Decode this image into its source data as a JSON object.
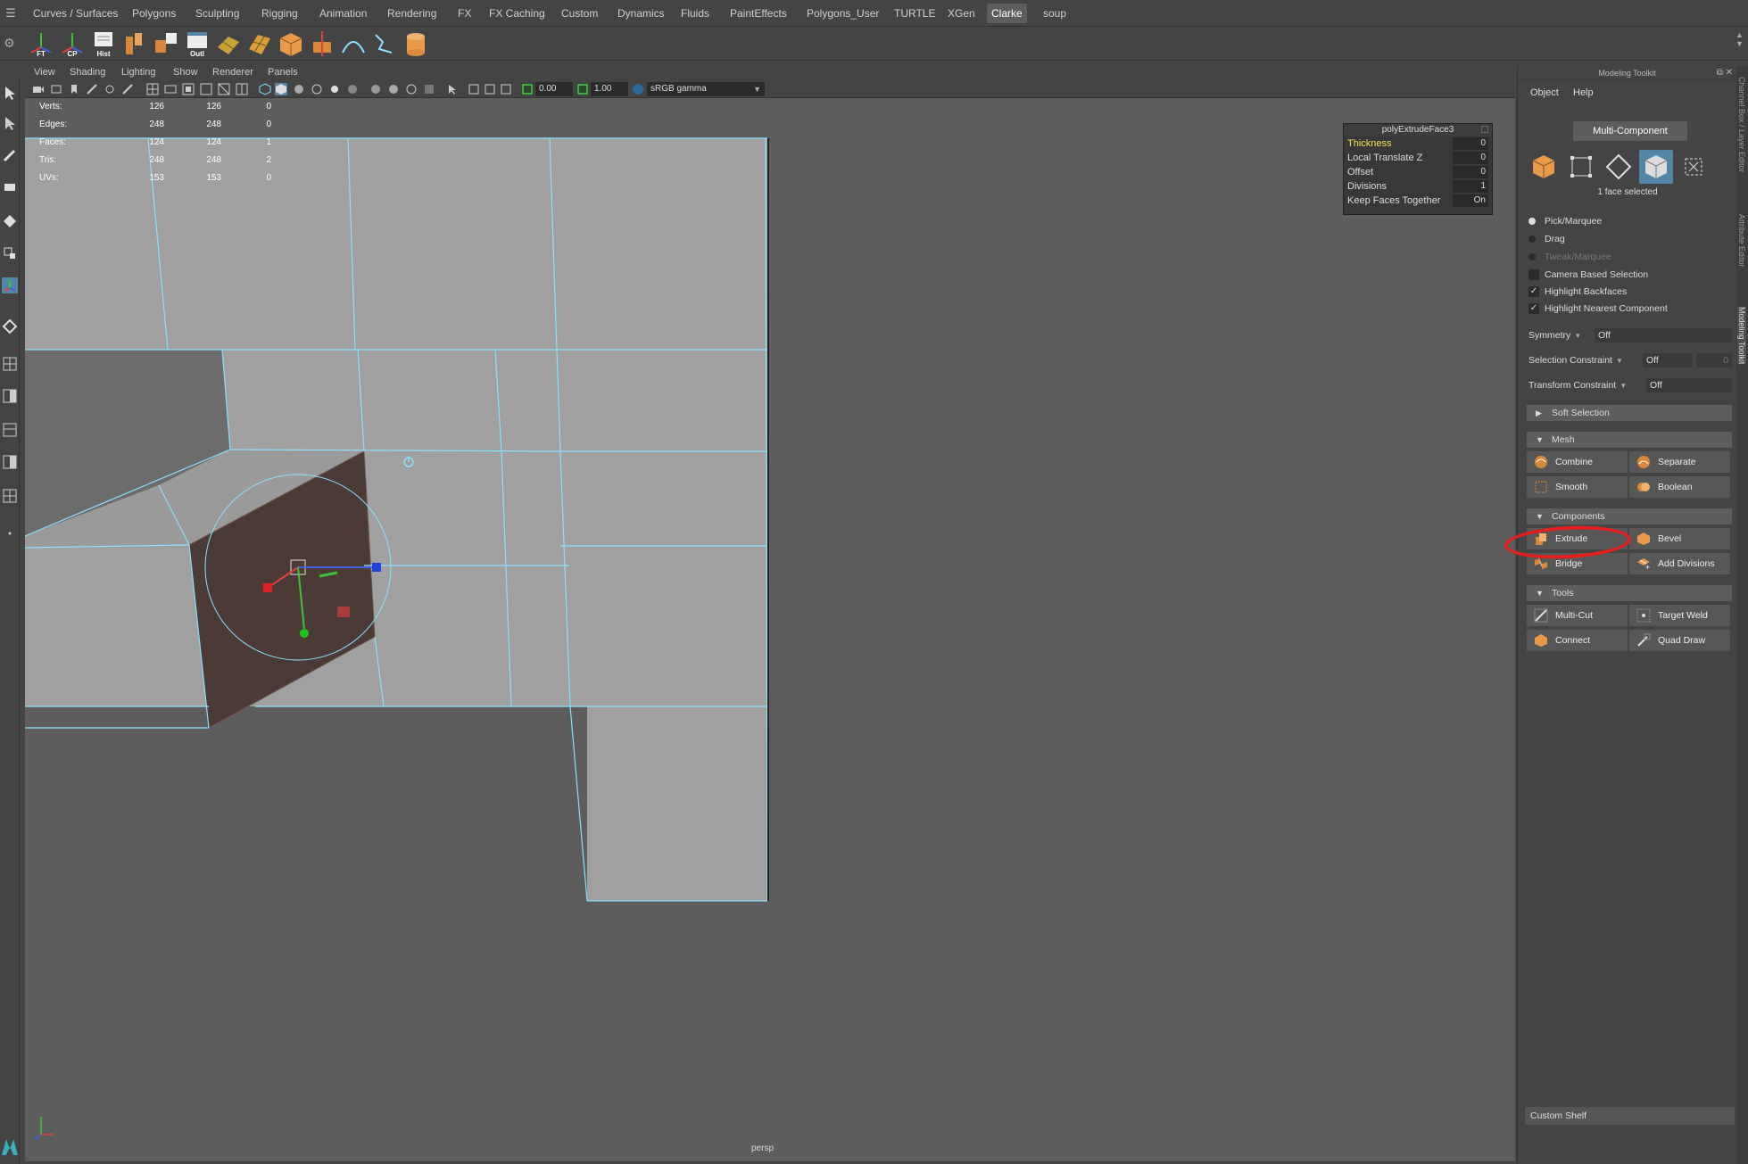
{
  "shelf": {
    "tabs": [
      "Curves / Surfaces",
      "Polygons",
      "Sculpting",
      "Rigging",
      "Animation",
      "Rendering",
      "FX",
      "FX Caching",
      "Custom",
      "Dynamics",
      "Fluids",
      "PaintEffects",
      "Polygons_User",
      "TURTLE",
      "XGen",
      "Clarke",
      "soup"
    ],
    "active_tab": "Clarke",
    "icon_labels": {
      "ft": "FT",
      "cp": "CP",
      "hist": "Hist",
      "outl": "Outl"
    }
  },
  "viewport": {
    "menu": [
      "View",
      "Shading",
      "Lighting",
      "Show",
      "Renderer",
      "Panels"
    ],
    "field_a": "0.00",
    "field_b": "1.00",
    "colorspace": "sRGB gamma",
    "camera": "persp",
    "hud": [
      {
        "label": "Verts:",
        "v1": "126",
        "v2": "126",
        "v3": "0"
      },
      {
        "label": "Edges:",
        "v1": "248",
        "v2": "248",
        "v3": "0"
      },
      {
        "label": "Faces:",
        "v1": "124",
        "v2": "124",
        "v3": "1"
      },
      {
        "label": "Tris:",
        "v1": "248",
        "v2": "248",
        "v3": "2"
      },
      {
        "label": "UVs:",
        "v1": "153",
        "v2": "153",
        "v3": "0"
      }
    ]
  },
  "inview_editor": {
    "title": "polyExtrudeFace3",
    "rows": [
      {
        "label": "Thickness",
        "value": "0"
      },
      {
        "label": "Local Translate Z",
        "value": "0"
      },
      {
        "label": "Offset",
        "value": "0"
      },
      {
        "label": "Divisions",
        "value": "1"
      },
      {
        "label": "Keep Faces Together",
        "value": "On"
      }
    ]
  },
  "toolkit": {
    "title": "Modeling Toolkit",
    "menu": {
      "object": "Object",
      "help": "Help"
    },
    "multi_component": "Multi-Component",
    "selection_count": "1 face selected",
    "pick_marquee": "Pick/Marquee",
    "drag": "Drag",
    "tweak_marquee": "Tweak/Marquee",
    "camera_based": "Camera Based Selection",
    "highlight_backfaces": "Highlight Backfaces",
    "highlight_nearest": "Highlight Nearest Component",
    "symmetry": {
      "label": "Symmetry",
      "value": "Off"
    },
    "selection_constraint": {
      "label": "Selection Constraint",
      "value": "Off",
      "num": "0"
    },
    "transform_constraint": {
      "label": "Transform Constraint",
      "value": "Off"
    },
    "soft_selection": "Soft Selection",
    "mesh": {
      "header": "Mesh",
      "combine": "Combine",
      "separate": "Separate",
      "smooth": "Smooth",
      "boolean": "Boolean"
    },
    "components": {
      "header": "Components",
      "extrude": "Extrude",
      "bevel": "Bevel",
      "bridge": "Bridge",
      "add_divisions": "Add Divisions"
    },
    "tools": {
      "header": "Tools",
      "multi_cut": "Multi-Cut",
      "target_weld": "Target Weld",
      "connect": "Connect",
      "quad_draw": "Quad Draw"
    }
  },
  "custom_shelf": "Custom Shelf",
  "right_tabs": [
    "Channel Box / Layer Editor",
    "Attribute Editor",
    "Modeling Toolkit"
  ],
  "colors": {
    "accent": "#5285a6",
    "wire": "#8ce0ff",
    "highlight": "#f5e54a",
    "annotation": "#e32020"
  }
}
